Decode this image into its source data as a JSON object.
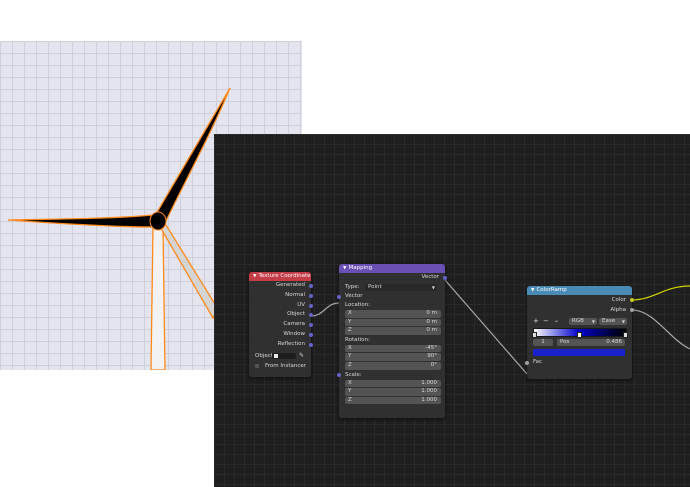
{
  "texture_coordinate": {
    "title": "Texture Coordinate",
    "outputs": [
      "Generated",
      "Normal",
      "UV",
      "Object",
      "Camera",
      "Window",
      "Reflection"
    ],
    "object_label": "Object:",
    "object_value": "",
    "from_instancer": "From Instancer"
  },
  "mapping": {
    "title": "Mapping",
    "output": "Vector",
    "type_label": "Type:",
    "type_value": "Point",
    "vector_input": "Vector",
    "location_label": "Location:",
    "location": [
      {
        "axis": "X",
        "value": "0 m"
      },
      {
        "axis": "Y",
        "value": "0 m"
      },
      {
        "axis": "Z",
        "value": "0 m"
      }
    ],
    "rotation_label": "Rotation:",
    "rotation": [
      {
        "axis": "X",
        "value": "-45°"
      },
      {
        "axis": "Y",
        "value": "90°"
      },
      {
        "axis": "Z",
        "value": "0°"
      }
    ],
    "scale_label": "Scale:",
    "scale": [
      {
        "axis": "X",
        "value": "1.000"
      },
      {
        "axis": "Y",
        "value": "1.000"
      },
      {
        "axis": "Z",
        "value": "1.000"
      }
    ]
  },
  "color_ramp": {
    "title": "ColorRamp",
    "outputs": [
      "Color",
      "Alpha"
    ],
    "add_label": "+",
    "remove_label": "−",
    "color_mode": "RGB",
    "interpolation": "Ease",
    "stop_index": "1",
    "pos_label": "Pos",
    "pos_value": "0.486",
    "input": "Fac"
  },
  "colors": {
    "tex_coord_header": "#c43c45",
    "mapping_header": "#6a4fb5",
    "color_ramp_header": "#4a8bb5",
    "ramp_selected_color": "#1a22cc",
    "vector_socket": "#6363c7",
    "color_socket": "#c7c729",
    "float_socket": "#a1a1a1"
  }
}
